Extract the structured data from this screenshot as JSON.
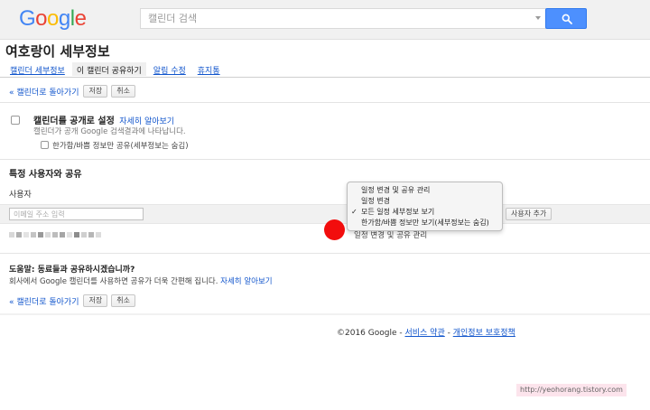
{
  "header": {
    "logo_letters": [
      {
        "ch": "G",
        "color": "#4285f4"
      },
      {
        "ch": "o",
        "color": "#ea4335"
      },
      {
        "ch": "o",
        "color": "#fbbc05"
      },
      {
        "ch": "g",
        "color": "#4285f4"
      },
      {
        "ch": "l",
        "color": "#34a853"
      },
      {
        "ch": "e",
        "color": "#ea4335"
      }
    ],
    "search_placeholder": "캘린더 검색",
    "search_button_icon": "magnifier-icon"
  },
  "page_title": "여호랑이 세부정보",
  "tabs": [
    {
      "label": "캘린더 세부정보",
      "active": false
    },
    {
      "label": "이 캘린더 공유하기",
      "active": true
    },
    {
      "label": "알림 수정",
      "active": false
    },
    {
      "label": "휴지통",
      "active": false
    }
  ],
  "actions": {
    "back_label": "« 캘린더로 돌아가기",
    "save_label": "저장",
    "cancel_label": "취소"
  },
  "public": {
    "title": "캘린더를 공개로 설정",
    "learn_more": "자세히 알아보기",
    "description": "캘린더가 공개 Google 검색결과에 나타납니다.",
    "option_label": "한가함/바쁨 정보만 공유(세부정보는 숨김)"
  },
  "share": {
    "title": "특정 사용자와 공유",
    "user_column": "사용자",
    "email_placeholder": "이메일 주소 입력",
    "add_person_label": "사용자 추가",
    "row_permission": "일정 변경 및 공유 관리"
  },
  "permission_menu": {
    "items": [
      {
        "label": "일정 변경 및 공유 관리",
        "checked": false
      },
      {
        "label": "일정 변경",
        "checked": false
      },
      {
        "label": "모든 일정 세부정보 보기",
        "checked": true
      },
      {
        "label": "한가함/바쁨 정보만 보기(세부정보는 숨김)",
        "checked": false
      }
    ],
    "check_mark": "✓"
  },
  "help": {
    "title": "도움말: 동료들과 공유하시겠습니까?",
    "description": "회사에서 Google 캘린더를 사용하면 공유가 더욱 간편해 집니다.",
    "learn_more": "자세히 알아보기"
  },
  "footer": {
    "copyright": "©2016 Google - ",
    "terms": "서비스 약관",
    "separator": " - ",
    "privacy": "개인정보 보호정책"
  },
  "watermark": "http://yeohorang.tistory.com"
}
